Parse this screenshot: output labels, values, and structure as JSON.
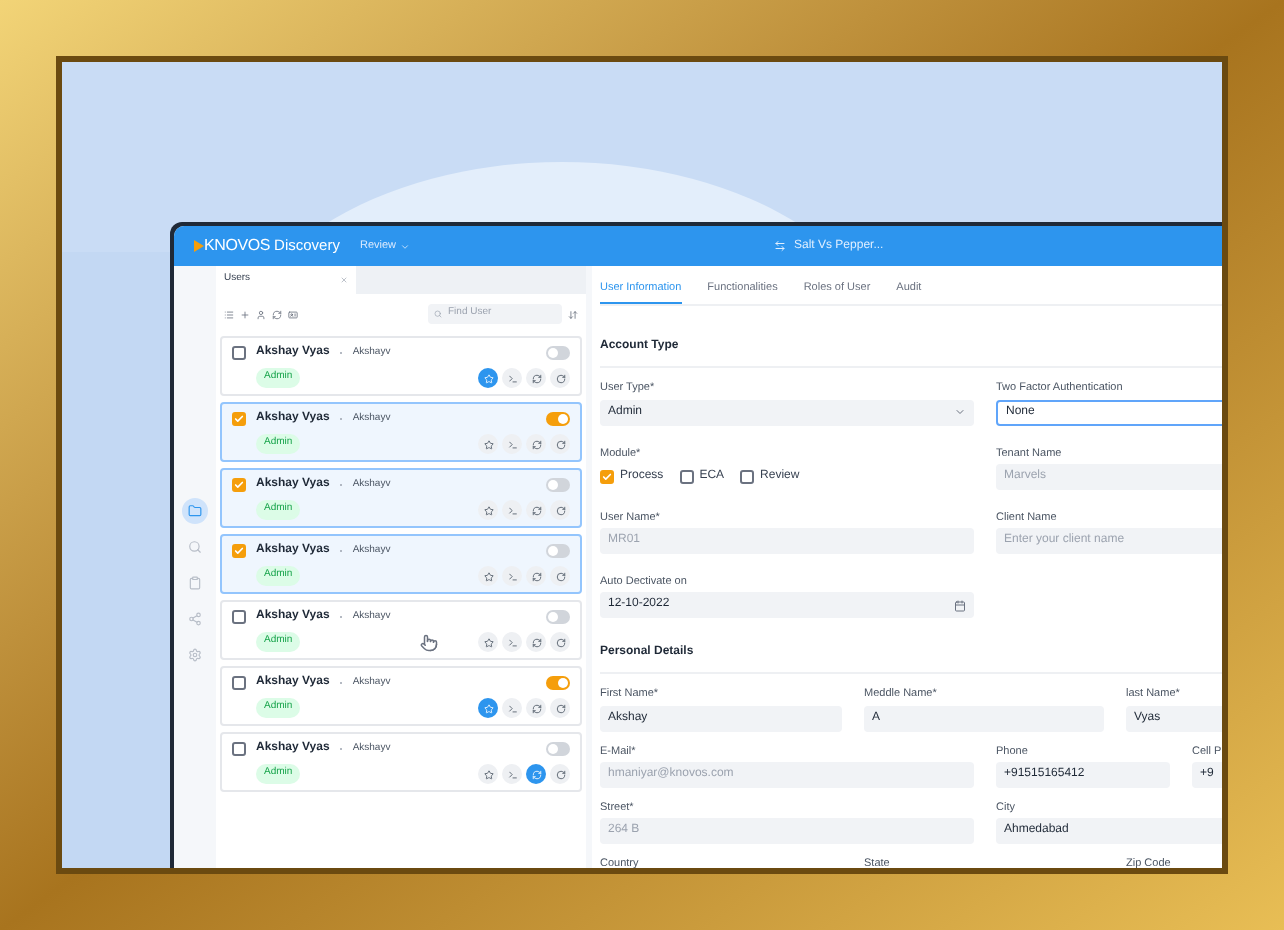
{
  "header": {
    "logo": "KNOVOS",
    "app_name": "Discovery",
    "menu": "Review",
    "project": "Salt Vs Pepper..."
  },
  "rail": [
    {
      "kind": "folder",
      "selected": true
    },
    {
      "kind": "search",
      "selected": false
    },
    {
      "kind": "clipboard",
      "selected": false
    },
    {
      "kind": "share",
      "selected": false
    },
    {
      "kind": "settings",
      "selected": false
    }
  ],
  "users_tab": {
    "label": "Users"
  },
  "search": {
    "placeholder": "Find User"
  },
  "users": [
    {
      "name": "Akshay Vyas",
      "username": "Akshayv",
      "role": "Admin",
      "checked": false,
      "selected": false,
      "on": false,
      "actions": [
        {
          "kind": "star",
          "active": true
        },
        {
          "kind": "terminal",
          "active": false
        },
        {
          "kind": "sync",
          "active": false
        },
        {
          "kind": "refresh",
          "active": false
        }
      ],
      "cursor": false
    },
    {
      "name": "Akshay Vyas",
      "username": "Akshayv",
      "role": "Admin",
      "checked": true,
      "selected": true,
      "on": true,
      "actions": [
        {
          "kind": "star",
          "active": false
        },
        {
          "kind": "terminal",
          "active": false
        },
        {
          "kind": "sync",
          "active": false
        },
        {
          "kind": "refresh",
          "active": false
        }
      ],
      "cursor": false
    },
    {
      "name": "Akshay Vyas",
      "username": "Akshayv",
      "role": "Admin",
      "checked": true,
      "selected": true,
      "on": false,
      "actions": [
        {
          "kind": "star",
          "active": false
        },
        {
          "kind": "terminal",
          "active": false
        },
        {
          "kind": "sync",
          "active": false
        },
        {
          "kind": "refresh",
          "active": false
        }
      ],
      "cursor": false
    },
    {
      "name": "Akshay Vyas",
      "username": "Akshayv",
      "role": "Admin",
      "checked": true,
      "selected": true,
      "on": false,
      "actions": [
        {
          "kind": "star",
          "active": false
        },
        {
          "kind": "terminal",
          "active": false
        },
        {
          "kind": "sync",
          "active": false
        },
        {
          "kind": "refresh",
          "active": false
        }
      ],
      "cursor": false
    },
    {
      "name": "Akshay Vyas",
      "username": "Akshayv",
      "role": "Admin",
      "checked": false,
      "selected": false,
      "on": false,
      "actions": [
        {
          "kind": "star",
          "active": false
        },
        {
          "kind": "terminal",
          "active": false
        },
        {
          "kind": "sync",
          "active": false
        },
        {
          "kind": "refresh",
          "active": false
        }
      ],
      "cursor": true
    },
    {
      "name": "Akshay Vyas",
      "username": "Akshayv",
      "role": "Admin",
      "checked": false,
      "selected": false,
      "on": true,
      "actions": [
        {
          "kind": "star",
          "active": true
        },
        {
          "kind": "terminal",
          "active": false
        },
        {
          "kind": "sync",
          "active": false
        },
        {
          "kind": "refresh",
          "active": false
        }
      ],
      "cursor": false
    },
    {
      "name": "Akshay Vyas",
      "username": "Akshayv",
      "role": "Admin",
      "checked": false,
      "selected": false,
      "on": false,
      "actions": [
        {
          "kind": "star",
          "active": false
        },
        {
          "kind": "terminal",
          "active": false
        },
        {
          "kind": "sync",
          "active": true
        },
        {
          "kind": "refresh",
          "active": false
        }
      ],
      "cursor": false
    }
  ],
  "detail_tabs": [
    {
      "label": "User Information",
      "selected": true
    },
    {
      "label": "Functionalities",
      "selected": false
    },
    {
      "label": "Roles of User",
      "selected": false
    },
    {
      "label": "Audit",
      "selected": false
    }
  ],
  "sections": [
    {
      "title": "Account Type",
      "rows": [
        [
          {
            "label": "User Type*",
            "kind": "select",
            "value": "Admin",
            "disabled": false,
            "focused": false
          },
          {
            "label": "Two Factor Authentication",
            "kind": "text",
            "value": "None",
            "disabled": false,
            "focused": true
          }
        ],
        [
          {
            "label": "Module*",
            "kind": "checkboxes",
            "options": [
              {
                "label": "Process",
                "checked": true
              },
              {
                "label": "ECA",
                "checked": false
              },
              {
                "label": "Review",
                "checked": false
              }
            ]
          },
          {
            "label": "Tenant Name",
            "kind": "text",
            "value": "Marvels",
            "disabled": true,
            "focused": false
          }
        ],
        [
          {
            "label": "User Name*",
            "kind": "text",
            "value": "MR01",
            "disabled": true,
            "focused": false
          },
          {
            "label": "Client Name",
            "kind": "text",
            "placeholder": "Enter your client name",
            "focused": false
          }
        ],
        [
          {
            "label": "Auto Dectivate on",
            "kind": "date",
            "value": "12-10-2022",
            "disabled": false,
            "focused": false
          }
        ]
      ]
    },
    {
      "title": "Personal Details",
      "rows": [
        [
          {
            "label": "First Name*",
            "kind": "text",
            "value": "Akshay",
            "disabled": false,
            "focused": false
          },
          {
            "label": "Meddle Name*",
            "kind": "text",
            "value": "A",
            "disabled": false,
            "focused": false
          },
          {
            "label": "last Name*",
            "kind": "text",
            "value": "Vyas",
            "disabled": false,
            "focused": false
          }
        ],
        [
          {
            "label": "E-Mail*",
            "kind": "text",
            "value": "hmaniyar@knovos.com",
            "disabled": true,
            "focused": false
          },
          {
            "label": "Phone",
            "kind": "text",
            "value": "+91515165412",
            "disabled": false,
            "focused": false
          },
          {
            "label": "Cell P",
            "kind": "text",
            "value": "+9",
            "disabled": false,
            "focused": false
          }
        ],
        [
          {
            "label": "Street*",
            "kind": "text",
            "value": "264 B",
            "disabled": true,
            "focused": false
          },
          {
            "label": "City",
            "kind": "text",
            "value": "Ahmedabad",
            "disabled": false,
            "focused": false
          }
        ],
        [
          {
            "label": "Country",
            "kind": "label"
          },
          {
            "label": "State",
            "kind": "label"
          },
          {
            "label": "Zip Code",
            "kind": "label"
          }
        ]
      ]
    }
  ]
}
